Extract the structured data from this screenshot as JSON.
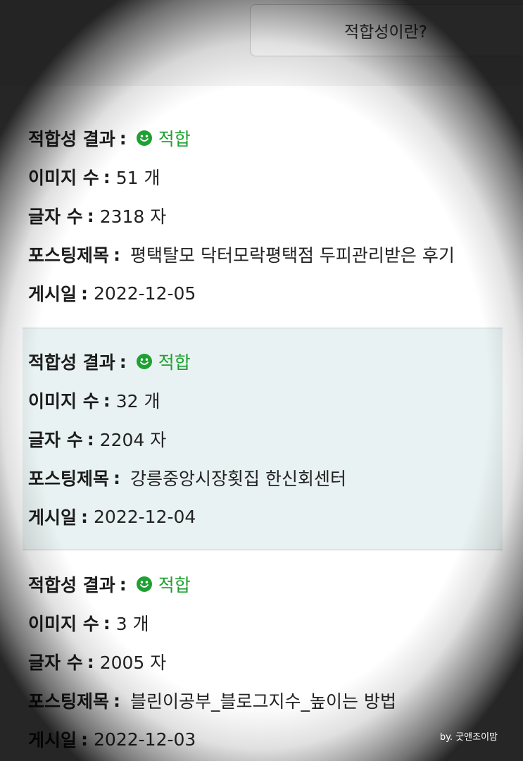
{
  "header": {
    "what_is_button": "적합성이란?"
  },
  "labels": {
    "result": "적합성 결과",
    "image_count": "이미지 수",
    "char_count": "글자 수",
    "post_title": "포스팅제목",
    "post_date": "게시일",
    "colon": ":"
  },
  "status_color": "#1fa032",
  "highlight_color": "#e9f2f2",
  "entries": [
    {
      "result": "적합",
      "image_count": "51 개",
      "char_count": "2318 자",
      "title": "평택탈모 닥터모락평택점 두피관리받은 후기",
      "date": "2022-12-05"
    },
    {
      "result": "적합",
      "image_count": "32 개",
      "char_count": "2204 자",
      "title": "강릉중앙시장횟집 한신회센터",
      "date": "2022-12-04"
    },
    {
      "result": "적합",
      "image_count": "3 개",
      "char_count": "2005 자",
      "title": "블린이공부_블로그지수_높이는 방법",
      "date": "2022-12-03"
    }
  ],
  "watermark": "by. 굿앤조이맘"
}
